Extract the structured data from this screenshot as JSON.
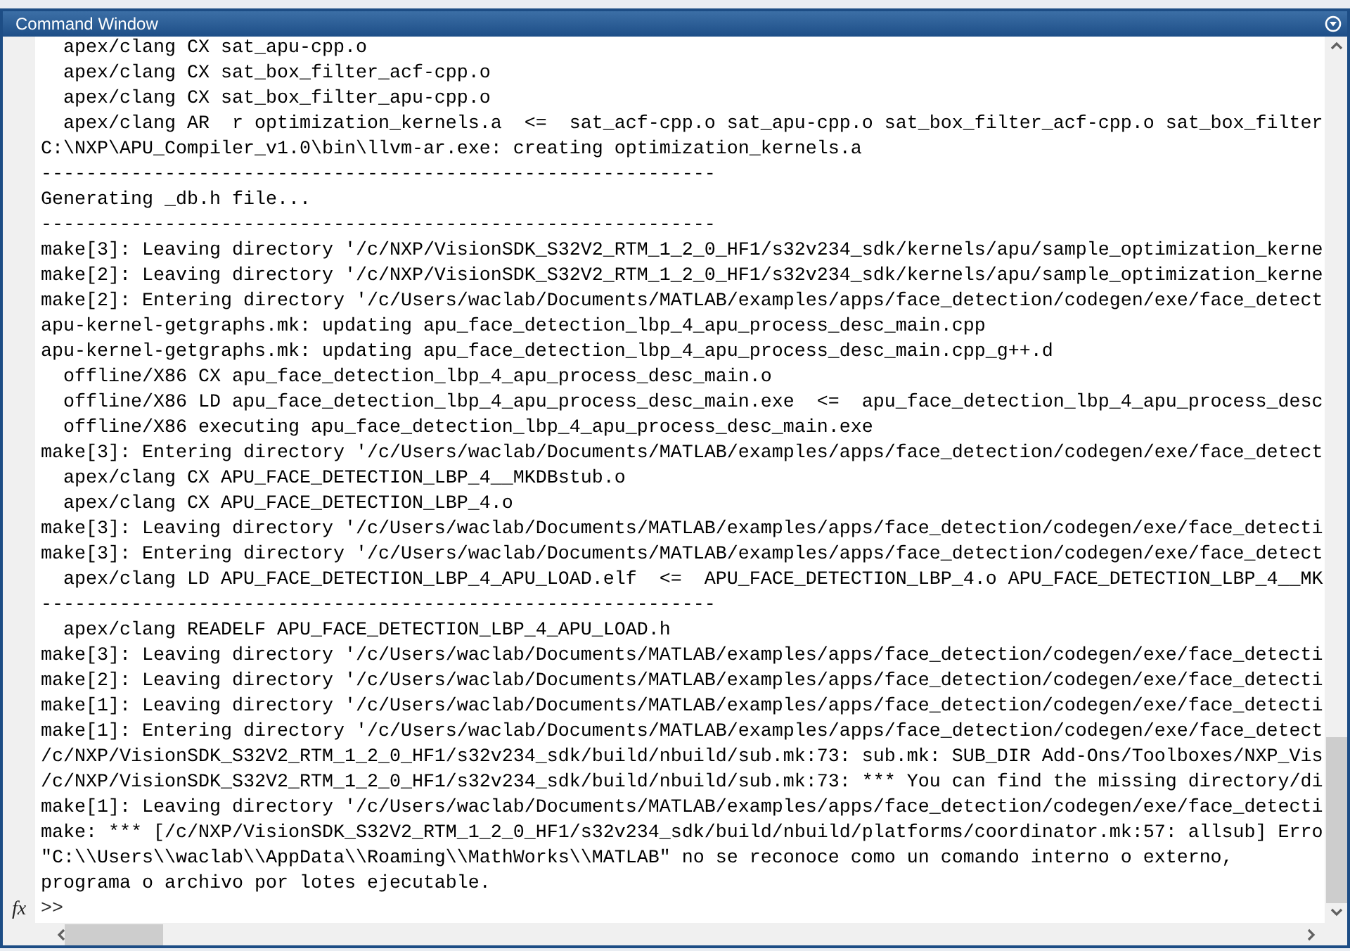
{
  "window": {
    "title": "Command Window"
  },
  "output_lines": [
    "  apex/clang CX sat_apu-cpp.o",
    "  apex/clang CX sat_box_filter_acf-cpp.o",
    "  apex/clang CX sat_box_filter_apu-cpp.o",
    "  apex/clang AR  r optimization_kernels.a  <=  sat_acf-cpp.o sat_apu-cpp.o sat_box_filter_acf-cpp.o sat_box_filter",
    "C:\\NXP\\APU_Compiler_v1.0\\bin\\llvm-ar.exe: creating optimization_kernels.a",
    "------------------------------------------------------------",
    "Generating _db.h file...",
    "------------------------------------------------------------",
    "make[3]: Leaving directory '/c/NXP/VisionSDK_S32V2_RTM_1_2_0_HF1/s32v234_sdk/kernels/apu/sample_optimization_kerne",
    "make[2]: Leaving directory '/c/NXP/VisionSDK_S32V2_RTM_1_2_0_HF1/s32v234_sdk/kernels/apu/sample_optimization_kerne",
    "make[2]: Entering directory '/c/Users/waclab/Documents/MATLAB/examples/apps/face_detection/codegen/exe/face_detect",
    "apu-kernel-getgraphs.mk: updating apu_face_detection_lbp_4_apu_process_desc_main.cpp",
    "apu-kernel-getgraphs.mk: updating apu_face_detection_lbp_4_apu_process_desc_main.cpp_g++.d",
    "  offline/X86 CX apu_face_detection_lbp_4_apu_process_desc_main.o",
    "  offline/X86 LD apu_face_detection_lbp_4_apu_process_desc_main.exe  <=  apu_face_detection_lbp_4_apu_process_desc",
    "  offline/X86 executing apu_face_detection_lbp_4_apu_process_desc_main.exe",
    "make[3]: Entering directory '/c/Users/waclab/Documents/MATLAB/examples/apps/face_detection/codegen/exe/face_detect",
    "  apex/clang CX APU_FACE_DETECTION_LBP_4__MKDBstub.o",
    "  apex/clang CX APU_FACE_DETECTION_LBP_4.o",
    "make[3]: Leaving directory '/c/Users/waclab/Documents/MATLAB/examples/apps/face_detection/codegen/exe/face_detecti",
    "make[3]: Entering directory '/c/Users/waclab/Documents/MATLAB/examples/apps/face_detection/codegen/exe/face_detect",
    "  apex/clang LD APU_FACE_DETECTION_LBP_4_APU_LOAD.elf  <=  APU_FACE_DETECTION_LBP_4.o APU_FACE_DETECTION_LBP_4__MK",
    "------------------------------------------------------------",
    "  apex/clang READELF APU_FACE_DETECTION_LBP_4_APU_LOAD.h",
    "make[3]: Leaving directory '/c/Users/waclab/Documents/MATLAB/examples/apps/face_detection/codegen/exe/face_detecti",
    "make[2]: Leaving directory '/c/Users/waclab/Documents/MATLAB/examples/apps/face_detection/codegen/exe/face_detecti",
    "make[1]: Leaving directory '/c/Users/waclab/Documents/MATLAB/examples/apps/face_detection/codegen/exe/face_detecti",
    "make[1]: Entering directory '/c/Users/waclab/Documents/MATLAB/examples/apps/face_detection/codegen/exe/face_detect",
    "/c/NXP/VisionSDK_S32V2_RTM_1_2_0_HF1/s32v234_sdk/build/nbuild/sub.mk:73: sub.mk: SUB_DIR Add-Ons/Toolboxes/NXP_Vis",
    "/c/NXP/VisionSDK_S32V2_RTM_1_2_0_HF1/s32v234_sdk/build/nbuild/sub.mk:73: *** You can find the missing directory/di",
    "make[1]: Leaving directory '/c/Users/waclab/Documents/MATLAB/examples/apps/face_detection/codegen/exe/face_detecti",
    "make: *** [/c/NXP/VisionSDK_S32V2_RTM_1_2_0_HF1/s32v234_sdk/build/nbuild/platforms/coordinator.mk:57: allsub] Erro",
    "\"C:\\\\Users\\\\waclab\\\\AppData\\\\Roaming\\\\MathWorks\\\\MATLAB\" no se reconoce como un comando interno o externo,",
    "programa o archivo por lotes ejecutable."
  ],
  "prompt": {
    "fx_label": "fx",
    "symbol": ">>"
  }
}
